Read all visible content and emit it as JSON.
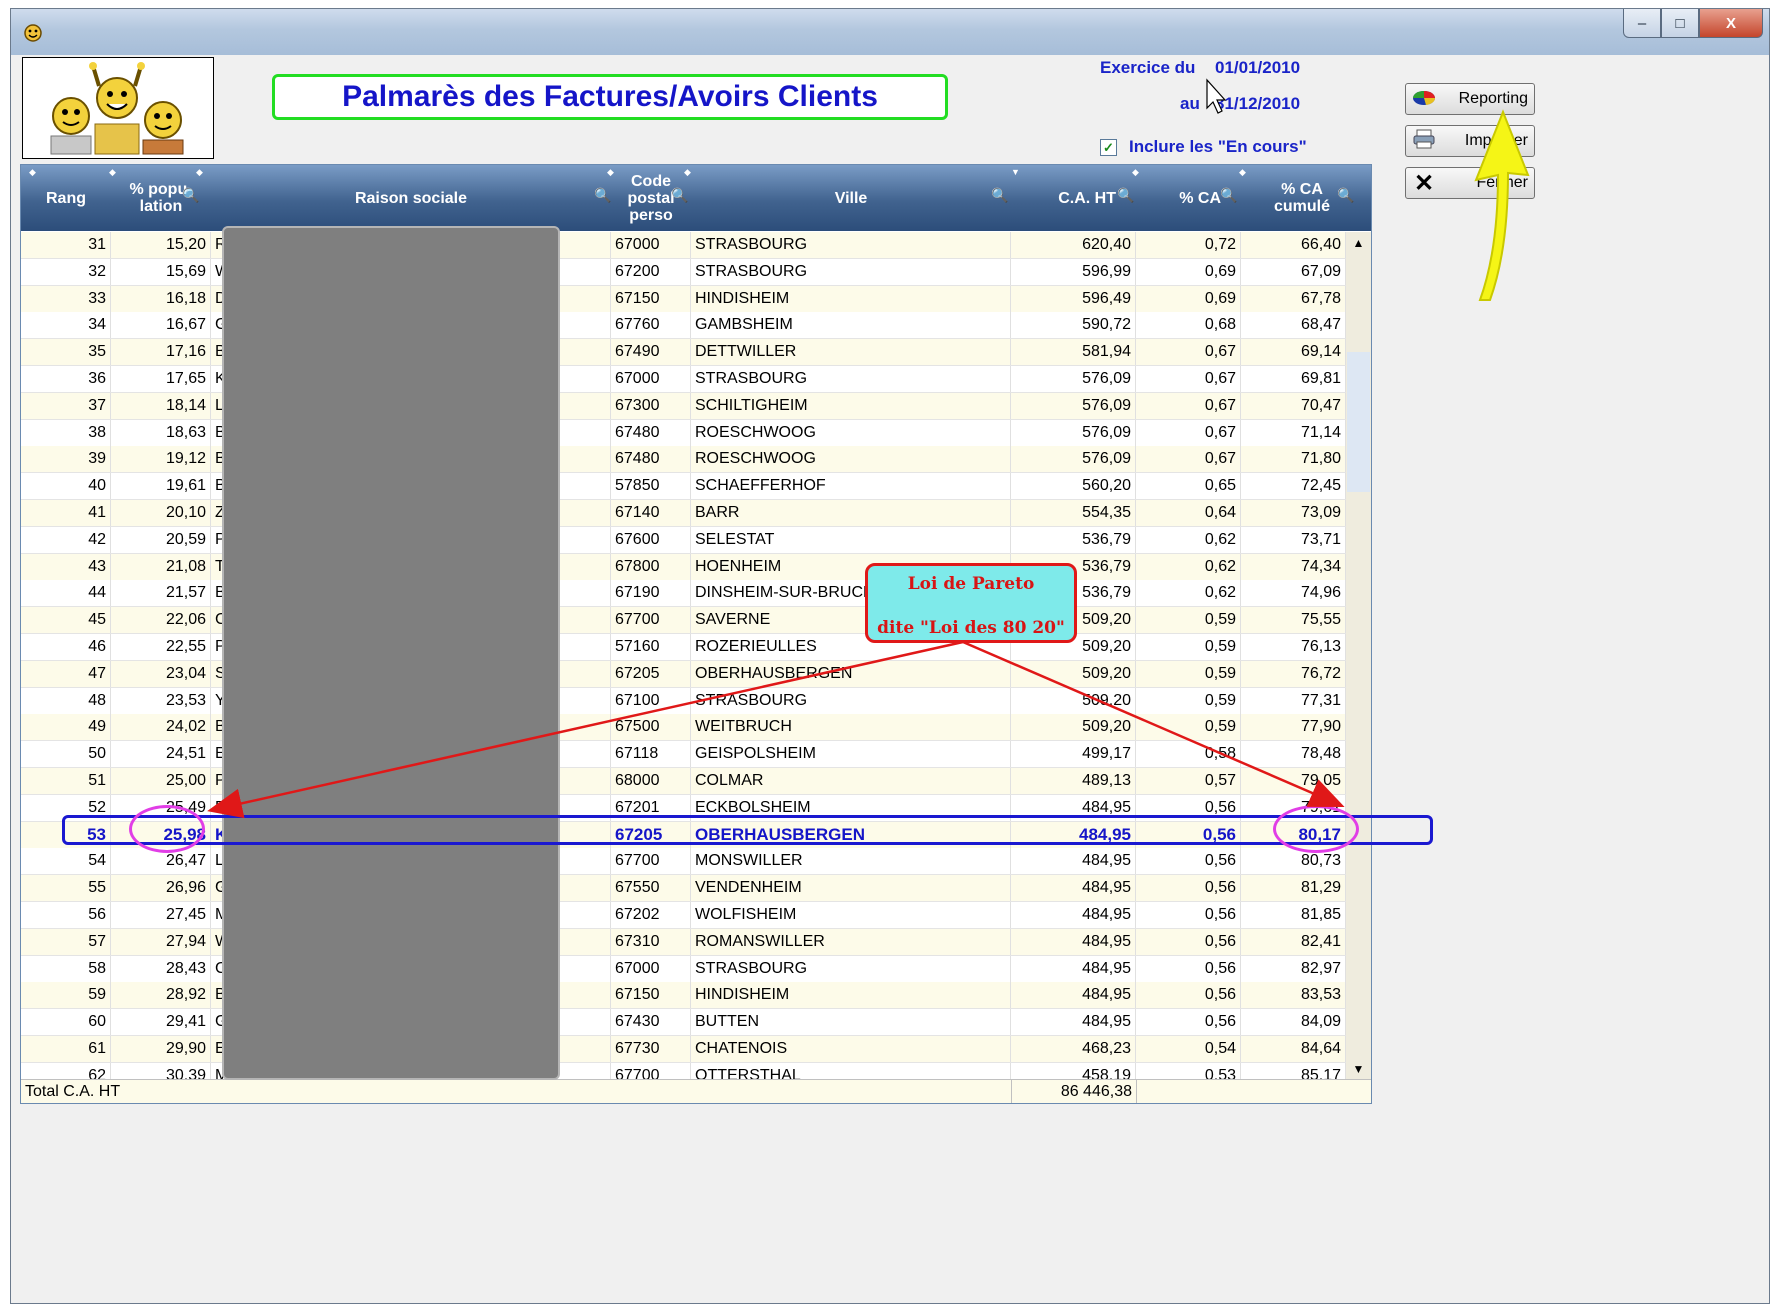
{
  "window": {
    "app_icon": "wd-app-icon",
    "buttons": [
      "minimize",
      "maximize",
      "close"
    ],
    "min_glyph": "–",
    "max_glyph": "□",
    "close_glyph": "X"
  },
  "header": {
    "title": "Palmarès des Factures/Avoirs Clients",
    "exercice_label": "Exercice du",
    "date_from": "01/01/2010",
    "au_label": "au",
    "date_to": "31/12/2010",
    "include_label": "Inclure les \"En cours\"",
    "include_checked": true
  },
  "side_buttons": {
    "reporting": "Reporting",
    "imprimer": "Imprimer",
    "fermer": "Fermer"
  },
  "table": {
    "columns": {
      "rang": "Rang",
      "population": "% popu-\nlation",
      "raison": "Raison sociale",
      "code_postal": "Code\npostal\nperso",
      "ville": "Ville",
      "ca_ht": "C.A. HT",
      "pct_ca": "% CA",
      "pct_cum": "% CA\ncumulé"
    },
    "rows": [
      {
        "rang": "31",
        "pop": "15,20",
        "rs": "RA",
        "cp": "67000",
        "ville": "STRASBOURG",
        "ca": "620,40",
        "pct": "0,72",
        "cum": "66,40"
      },
      {
        "rang": "32",
        "pop": "15,69",
        "rs": "WE",
        "cp": "67200",
        "ville": "STRASBOURG",
        "ca": "596,99",
        "pct": "0,69",
        "cum": "67,09"
      },
      {
        "rang": "33",
        "pop": "16,18",
        "rs": "DE",
        "cp": "67150",
        "ville": "HINDISHEIM",
        "ca": "596,49",
        "pct": "0,69",
        "cum": "67,78"
      },
      {
        "rang": "34",
        "pop": "16,67",
        "rs": "Ga",
        "cp": "67760",
        "ville": "GAMBSHEIM",
        "ca": "590,72",
        "pct": "0,68",
        "cum": "68,47"
      },
      {
        "rang": "35",
        "pop": "17,16",
        "rs": "BA",
        "cp": "67490",
        "ville": "DETTWILLER",
        "ca": "581,94",
        "pct": "0,67",
        "cum": "69,14"
      },
      {
        "rang": "36",
        "pop": "17,65",
        "rs": "KU",
        "cp": "67000",
        "ville": "STRASBOURG",
        "ca": "576,09",
        "pct": "0,67",
        "cum": "69,81"
      },
      {
        "rang": "37",
        "pop": "18,14",
        "rs": "LA",
        "cp": "67300",
        "ville": "SCHILTIGHEIM",
        "ca": "576,09",
        "pct": "0,67",
        "cum": "70,47"
      },
      {
        "rang": "38",
        "pop": "18,63",
        "rs": "BU",
        "cp": "67480",
        "ville": "ROESCHWOOG",
        "ca": "576,09",
        "pct": "0,67",
        "cum": "71,14"
      },
      {
        "rang": "39",
        "pop": "19,12",
        "rs": "BU",
        "cp": "67480",
        "ville": "ROESCHWOOG",
        "ca": "576,09",
        "pct": "0,67",
        "cum": "71,80"
      },
      {
        "rang": "40",
        "pop": "19,61",
        "rs": "BA",
        "cp": "57850",
        "ville": "SCHAEFFERHOF",
        "ca": "560,20",
        "pct": "0,65",
        "cum": "72,45"
      },
      {
        "rang": "41",
        "pop": "20,10",
        "rs": "ZII",
        "cp": "67140",
        "ville": "BARR",
        "ca": "554,35",
        "pct": "0,64",
        "cum": "73,09"
      },
      {
        "rang": "42",
        "pop": "20,59",
        "rs": "PE",
        "cp": "67600",
        "ville": "SELESTAT",
        "ca": "536,79",
        "pct": "0,62",
        "cum": "73,71"
      },
      {
        "rang": "43",
        "pop": "21,08",
        "rs": "TR",
        "cp": "67800",
        "ville": "HOENHEIM",
        "ca": "536,79",
        "pct": "0,62",
        "cum": "74,34"
      },
      {
        "rang": "44",
        "pop": "21,57",
        "rs": "BE",
        "cp": "67190",
        "ville": "DINSHEIM-SUR-BRUCHE",
        "ca": "536,79",
        "pct": "0,62",
        "cum": "74,96"
      },
      {
        "rang": "45",
        "pop": "22,06",
        "rs": "CU",
        "cp": "67700",
        "ville": "SAVERNE",
        "ca": "509,20",
        "pct": "0,59",
        "cum": "75,55"
      },
      {
        "rang": "46",
        "pop": "22,55",
        "rs": "PE",
        "cp": "57160",
        "ville": "ROZERIEULLES",
        "ca": "509,20",
        "pct": "0,59",
        "cum": "76,13"
      },
      {
        "rang": "47",
        "pop": "23,04",
        "rs": "SC",
        "cp": "67205",
        "ville": "OBERHAUSBERGEN",
        "ca": "509,20",
        "pct": "0,59",
        "cum": "76,72"
      },
      {
        "rang": "48",
        "pop": "23,53",
        "rs": "YO",
        "cp": "67100",
        "ville": "STRASBOURG",
        "ca": "509,20",
        "pct": "0,59",
        "cum": "77,31"
      },
      {
        "rang": "49",
        "pop": "24,02",
        "rs": "BA",
        "cp": "67500",
        "ville": "WEITBRUCH",
        "ca": "509,20",
        "pct": "0,59",
        "cum": "77,90"
      },
      {
        "rang": "50",
        "pop": "24,51",
        "rs": "ED",
        "cp": "67118",
        "ville": "GEISPOLSHEIM",
        "ca": "499,17",
        "pct": "0,58",
        "cum": "78,48"
      },
      {
        "rang": "51",
        "pop": "25,00",
        "rs": "PIE",
        "cp": "68000",
        "ville": "COLMAR",
        "ca": "489,13",
        "pct": "0,57",
        "cum": "79,05"
      },
      {
        "rang": "52",
        "pop": "25,49",
        "rs": "BO",
        "cp": "67201",
        "ville": "ECKBOLSHEIM",
        "ca": "484,95",
        "pct": "0,56",
        "cum": "79,61"
      },
      {
        "rang": "53",
        "pop": "25,98",
        "rs": "KO",
        "cp": "67205",
        "ville": "OBERHAUSBERGEN",
        "ca": "484,95",
        "pct": "0,56",
        "cum": "80,17",
        "hl": true
      },
      {
        "rang": "54",
        "pop": "26,47",
        "rs": "LIN",
        "cp": "67700",
        "ville": "MONSWILLER",
        "ca": "484,95",
        "pct": "0,56",
        "cum": "80,73"
      },
      {
        "rang": "55",
        "pop": "26,96",
        "rs": "GO",
        "cp": "67550",
        "ville": "VENDENHEIM",
        "ca": "484,95",
        "pct": "0,56",
        "cum": "81,29"
      },
      {
        "rang": "56",
        "pop": "27,45",
        "rs": "MU",
        "cp": "67202",
        "ville": "WOLFISHEIM",
        "ca": "484,95",
        "pct": "0,56",
        "cum": "81,85"
      },
      {
        "rang": "57",
        "pop": "27,94",
        "rs": "WE",
        "cp": "67310",
        "ville": "ROMANSWILLER",
        "ca": "484,95",
        "pct": "0,56",
        "cum": "82,41"
      },
      {
        "rang": "58",
        "pop": "28,43",
        "rs": "CH",
        "cp": "67000",
        "ville": "STRASBOURG",
        "ca": "484,95",
        "pct": "0,56",
        "cum": "82,97"
      },
      {
        "rang": "59",
        "pop": "28,92",
        "rs": "BLO",
        "cp": "67150",
        "ville": "HINDISHEIM",
        "ca": "484,95",
        "pct": "0,56",
        "cum": "83,53"
      },
      {
        "rang": "60",
        "pop": "29,41",
        "rs": "GE",
        "cp": "67430",
        "ville": "BUTTEN",
        "ca": "484,95",
        "pct": "0,56",
        "cum": "84,09"
      },
      {
        "rang": "61",
        "pop": "29,90",
        "rs": "EB",
        "cp": "67730",
        "ville": "CHATENOIS",
        "ca": "468,23",
        "pct": "0,54",
        "cum": "84,64"
      },
      {
        "rang": "62",
        "pop": "30,39",
        "rs": "MC",
        "cp": "67700",
        "ville": "OTTERSTHAL",
        "ca": "458,19",
        "pct": "0,53",
        "cum": "85,17"
      }
    ],
    "total_label": "Total C.A. HT",
    "total_value": "86 446,38"
  },
  "annotation": {
    "line1": "Loi de Pareto",
    "line2": "dite \"Loi des 80 20\"",
    "colors": {
      "arrow": "#e01818",
      "highlight": "#1a18d0",
      "circle": "#e13ee6",
      "pointer": "#f5f516"
    }
  }
}
